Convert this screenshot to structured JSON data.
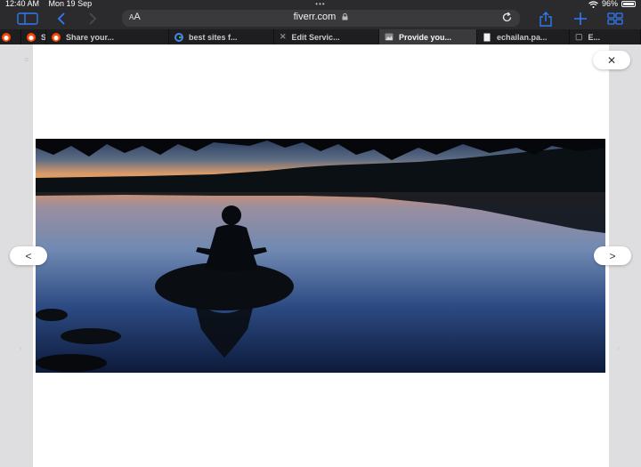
{
  "status_bar": {
    "time": "12:40 AM",
    "date": "Mon 19 Sep",
    "battery": "96%",
    "battery_level": 0.96
  },
  "toolbar": {
    "aa_small": "A",
    "aa_large": "A",
    "url": "fiverr.com"
  },
  "tabs": [
    {
      "label": "S",
      "icon": "reddit-icon"
    },
    {
      "label": "Share your...",
      "icon": "reddit-icon"
    },
    {
      "label": "best sites f...",
      "icon": "google-icon"
    },
    {
      "label": "Edit Servic...",
      "icon": "page-icon"
    },
    {
      "label": "Provide you...",
      "icon": "image-icon"
    },
    {
      "label": "echailan.pa...",
      "icon": "document-icon"
    },
    {
      "label": "E...",
      "icon": "page-icon"
    }
  ],
  "lightbox": {
    "close_symbol": "✕",
    "prev_symbol": "<",
    "next_symbol": ">"
  },
  "colors": {
    "accent": "#2f7bf6",
    "chrome_bg": "#2b2b2d",
    "address_bg": "#3a3a3c",
    "page_bg": "#e3e3e6"
  }
}
